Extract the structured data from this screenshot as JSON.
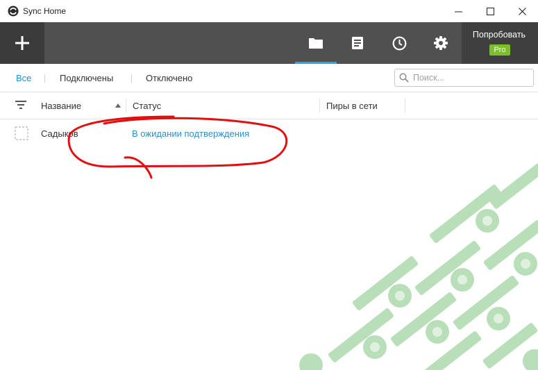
{
  "window": {
    "title": "Sync Home"
  },
  "toolbar": {
    "add_icon": "plus-icon",
    "tabs": [
      {
        "icon": "folder-icon",
        "active": true
      },
      {
        "icon": "document-icon",
        "active": false
      },
      {
        "icon": "clock-icon",
        "active": false
      },
      {
        "icon": "gear-icon",
        "active": false
      }
    ],
    "promo_label": "Попробовать",
    "promo_badge": "Pro",
    "colors": {
      "dark": "#505050",
      "accent": "#2fa4e7",
      "pro": "#7bbf2a"
    }
  },
  "filters": {
    "all": "Все",
    "connected": "Подключены",
    "disconnected": "Отключено"
  },
  "search": {
    "placeholder": "Поиск...",
    "value": ""
  },
  "table": {
    "columns": [
      "Название",
      "Статус",
      "Пиры в сети"
    ],
    "rows": [
      {
        "name": "Садыков",
        "status": "В ожидании подтверждения"
      }
    ]
  }
}
